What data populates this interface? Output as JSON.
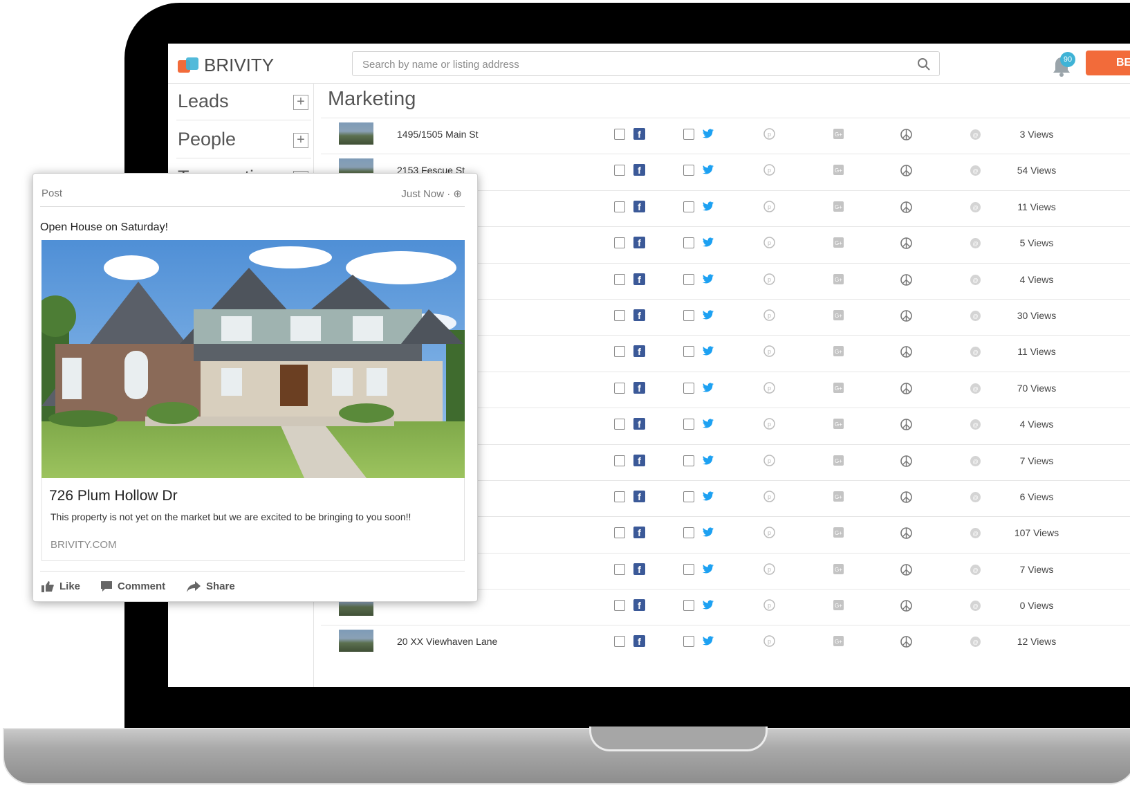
{
  "app": {
    "logo_text": "BRIVITY",
    "search_placeholder": "Search by name or listing address",
    "notification_count": "90",
    "top_button_label": "BEN",
    "brand_orange": "#f26b3a",
    "brand_blue": "#3fb3d6"
  },
  "sidebar": {
    "items": [
      {
        "label": "Leads"
      },
      {
        "label": "People"
      },
      {
        "label": "Transactions"
      }
    ]
  },
  "main": {
    "title": "Marketing",
    "rows": [
      {
        "address": "1495/1505 Main St",
        "views": "3 Views"
      },
      {
        "address": "2153 Fescue St",
        "views": "54 Views"
      },
      {
        "address": "",
        "views": "11 Views"
      },
      {
        "address": "",
        "views": "5 Views"
      },
      {
        "address": "",
        "views": "4 Views"
      },
      {
        "address": "",
        "views": "30 Views"
      },
      {
        "address": "",
        "views": "11 Views"
      },
      {
        "address": "",
        "views": "70 Views"
      },
      {
        "address": "",
        "views": "4 Views"
      },
      {
        "address": "",
        "views": "7 Views"
      },
      {
        "address": "",
        "views": "6 Views"
      },
      {
        "address": "",
        "views": "107 Views"
      },
      {
        "address": "",
        "views": "7 Views"
      },
      {
        "address": "",
        "views": "0 Views"
      },
      {
        "address": "20 XX Viewhaven Lane",
        "views": "12 Views"
      }
    ]
  },
  "post": {
    "header": "Post",
    "time": "Just Now · ⊕",
    "caption": "Open House on Saturday!",
    "card_title": "726 Plum Hollow Dr",
    "card_description": "This property is not yet on the market but we are excited to be bringing to you soon!!",
    "card_link": "BRIVITY.COM",
    "actions": {
      "like": "Like",
      "comment": "Comment",
      "share": "Share"
    }
  }
}
